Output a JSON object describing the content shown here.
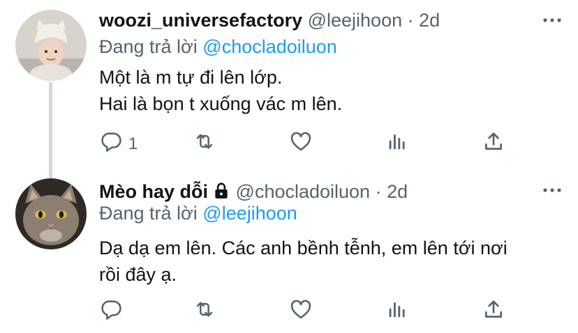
{
  "tweets": [
    {
      "name": "woozi_universefactory",
      "handle": "@leejihoon",
      "dot": "·",
      "time": "2d",
      "replying_label": "Đang trả lời",
      "replying_to": "@chocladoiluon",
      "text_lines": [
        "Một là m tự đi lên lớp.",
        "Hai là bọn t xuống vác m lên."
      ],
      "reply_count": "1",
      "locked": false
    },
    {
      "name": "Mèo hay dỗi",
      "handle": "@chocladoiluon",
      "dot": "·",
      "time": "2d",
      "replying_label": "Đang trả lời",
      "replying_to": "@leejihoon",
      "text_lines": [
        "Dạ dạ em lên. Các anh bềnh tễnh, em lên tới nơi",
        "rồi đây ạ."
      ],
      "reply_count": "",
      "locked": true
    }
  ],
  "colors": {
    "accent": "#1d9bf0",
    "secondary": "#536471",
    "thread_line": "#cfd9de"
  },
  "icons": [
    "reply-icon",
    "retweet-icon",
    "like-icon",
    "analytics-icon",
    "share-icon",
    "more-icon",
    "lock-icon"
  ]
}
